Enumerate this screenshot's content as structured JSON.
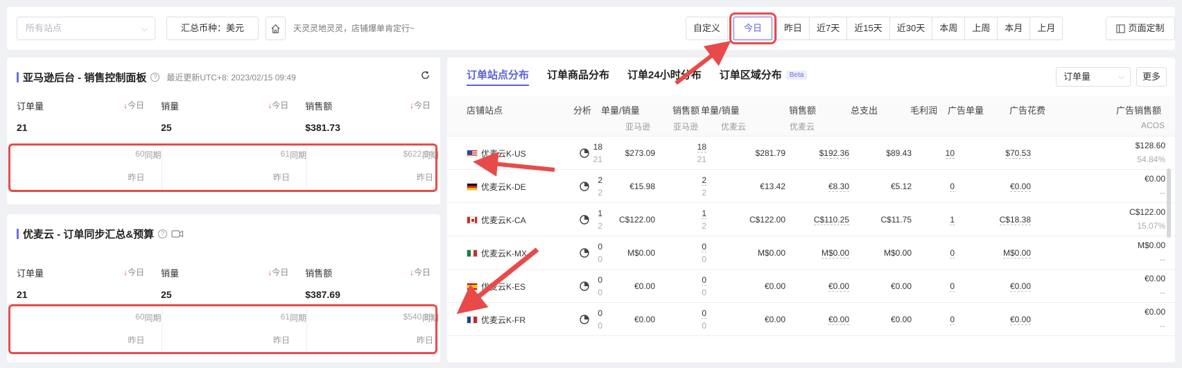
{
  "topbar": {
    "site_placeholder": "所有站点",
    "currency_label": "汇总币种：美元",
    "slogan": "天灵灵地灵灵，店铺爆单肯定行~",
    "ranges": [
      "自定义",
      "今日",
      "昨日",
      "近7天",
      "近15天",
      "近30天",
      "本周",
      "上周",
      "本月",
      "上月"
    ],
    "active_range": "今日",
    "custom_page": "页面定制"
  },
  "amazon_panel": {
    "title": "亚马逊后台 - 销售控制面板",
    "updated": "最近更新UTC+8: 2023/02/15 09:49",
    "metrics": [
      {
        "label": "订单量",
        "trend": "今日",
        "value": "21",
        "compare_label": "同期",
        "compare_value": "60",
        "yesterday": "昨日"
      },
      {
        "label": "销量",
        "trend": "今日",
        "value": "25",
        "compare_label": "同期",
        "compare_value": "61",
        "yesterday": "昨日"
      },
      {
        "label": "销售额",
        "trend": "今日",
        "value": "$381.73",
        "compare_label": "同期",
        "compare_value": "$622.04",
        "yesterday": "昨日"
      }
    ]
  },
  "youmai_panel": {
    "title": "优麦云 - 订单同步汇总&预算",
    "metrics": [
      {
        "label": "订单量",
        "trend": "今日",
        "value": "21",
        "compare_label": "同期",
        "compare_value": "60",
        "yesterday": "昨日"
      },
      {
        "label": "销量",
        "trend": "今日",
        "value": "25",
        "compare_label": "同期",
        "compare_value": "61",
        "yesterday": "昨日"
      },
      {
        "label": "销售额",
        "trend": "今日",
        "value": "$387.69",
        "compare_label": "同期",
        "compare_value": "$540.88",
        "yesterday": "昨日"
      }
    ]
  },
  "right_panel": {
    "tabs": [
      "订单站点分布",
      "订单商品分布",
      "订单24小时分布",
      "订单区域分布"
    ],
    "beta": "Beta",
    "metric_select": "订单量",
    "more": "更多",
    "headers": {
      "site": "店铺站点",
      "analysis": "分析",
      "units1": "单量/销量",
      "sales1": "销售额",
      "units2": "单量/销量",
      "sales2": "销售额",
      "total_cost": "总支出",
      "gross_profit": "毛利润",
      "ad_units": "广告单量",
      "ad_spend": "广告花费",
      "ad_sales": "广告销售额"
    },
    "subheaders": {
      "amazon1": "亚马逊",
      "amazon2": "亚马逊",
      "youmai1": "优麦云",
      "youmai2": "优麦云",
      "acos": "ACOS"
    },
    "rows": [
      {
        "site": "优麦云K-US",
        "flag": "us",
        "u1a": "18",
        "u1b": "21",
        "s1": "$273.09",
        "u2a": "18",
        "u2b": "21",
        "s2": "$281.79",
        "cost": "$192.36",
        "profit": "$89.43",
        "adu": "10",
        "ads": "$70.53",
        "adsales": "$128.60",
        "acos": "54.84%"
      },
      {
        "site": "优麦云K-DE",
        "flag": "de",
        "u1a": "2",
        "u1b": "2",
        "s1": "€15.98",
        "u2a": "2",
        "u2b": "2",
        "s2": "€13.42",
        "cost": "€8.30",
        "profit": "€5.12",
        "adu": "0",
        "ads": "€0.00",
        "adsales": "€0.00",
        "acos": "--"
      },
      {
        "site": "优麦云K-CA",
        "flag": "ca",
        "u1a": "1",
        "u1b": "2",
        "s1": "C$122.00",
        "u2a": "1",
        "u2b": "2",
        "s2": "C$122.00",
        "cost": "C$110.25",
        "profit": "C$11.75",
        "adu": "1",
        "ads": "C$18.38",
        "adsales": "C$122.00",
        "acos": "15.07%"
      },
      {
        "site": "优麦云K-MX",
        "flag": "mx",
        "u1a": "0",
        "u1b": "0",
        "s1": "M$0.00",
        "u2a": "0",
        "u2b": "0",
        "s2": "M$0.00",
        "cost": "M$0.00",
        "profit": "M$0.00",
        "adu": "0",
        "ads": "M$0.00",
        "adsales": "M$0.00",
        "acos": "--"
      },
      {
        "site": "优麦云K-ES",
        "flag": "es",
        "u1a": "0",
        "u1b": "0",
        "s1": "€0.00",
        "u2a": "0",
        "u2b": "0",
        "s2": "€0.00",
        "cost": "€0.00",
        "profit": "€0.00",
        "adu": "0",
        "ads": "€0.00",
        "adsales": "€0.00",
        "acos": "--"
      },
      {
        "site": "优麦云K-FR",
        "flag": "fr",
        "u1a": "0",
        "u1b": "0",
        "s1": "€0.00",
        "u2a": "0",
        "u2b": "0",
        "s2": "€0.00",
        "cost": "€0.00",
        "profit": "€0.00",
        "adu": "0",
        "ads": "€0.00",
        "adsales": "€0.00",
        "acos": "--"
      }
    ]
  },
  "colors": {
    "accent": "#5b5fe0",
    "annotation": "#e84a4a",
    "down": "#e04b4b"
  }
}
